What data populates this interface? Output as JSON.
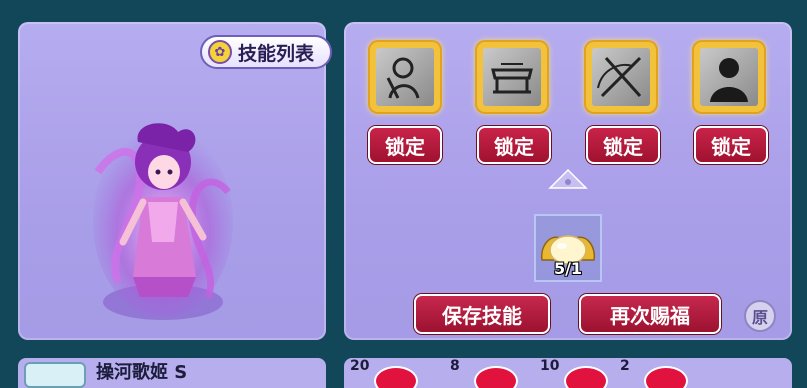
{
  "left_panel": {
    "skill_list_button": {
      "label": "技能列表"
    },
    "character_name_partial": "操河歌姬 S"
  },
  "right_panel": {
    "skill_slots": [
      {
        "icon": "human-silhouette-icon",
        "lock_label": "锁定"
      },
      {
        "icon": "scroll-banner-icon",
        "lock_label": "锁定"
      },
      {
        "icon": "crossed-swords-icon",
        "lock_label": "锁定"
      },
      {
        "icon": "robed-figure-icon",
        "lock_label": "锁定"
      }
    ],
    "item": {
      "icon": "golden-egg-icon",
      "count": "5/1"
    },
    "save_button": {
      "label": "保存技能"
    },
    "bless_button": {
      "label": "再次赐福"
    },
    "original_button": {
      "label": "原"
    }
  },
  "bottom_strip": {
    "stats": [
      "20",
      "8",
      "10",
      "2"
    ]
  },
  "colors": {
    "background": "#12475a",
    "panel": "#aea4ec",
    "lock_button": "#b01a3a",
    "slot_border": "#f3c23c"
  }
}
